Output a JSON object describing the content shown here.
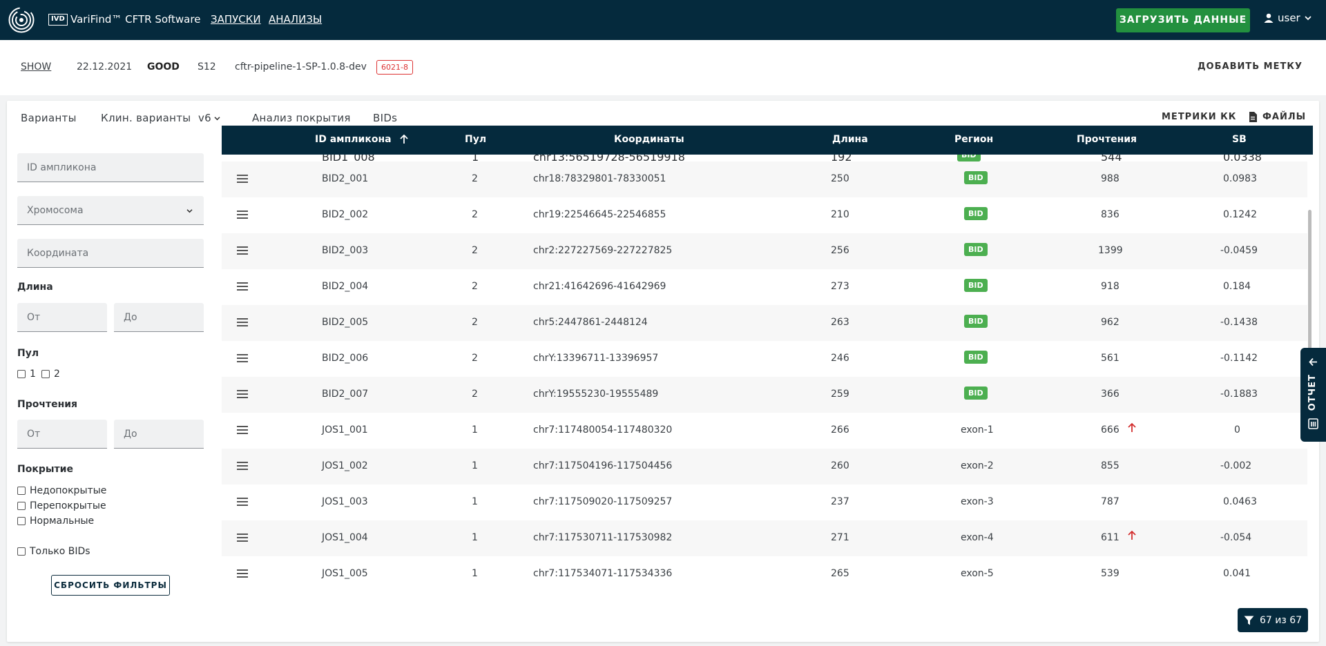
{
  "header": {
    "ivd_badge": "IVD",
    "app_title": "VariFind™ CFTR Software",
    "nav": [
      "ЗАПУСКИ",
      "АНАЛИЗЫ"
    ],
    "upload_label": "ЗАГРУЗИТЬ ДАННЫЕ",
    "user_label": "user"
  },
  "run": {
    "show_label": "SHOW",
    "date": "22.12.2021",
    "quality": "GOOD",
    "sample": "S12",
    "pipeline": "cftr-pipeline-1-SP-1.0.8-dev",
    "badge": "6021-8",
    "add_tag_label": "ДОБАВИТЬ МЕТКУ"
  },
  "tabs": {
    "variants": "Варианты",
    "clin_variants": "Клин. варианты",
    "version": "v6",
    "coverage": "Анализ покрытия",
    "bids": "BIDs",
    "qc_metrics": "МЕТРИКИ КК",
    "files": "ФАЙЛЫ"
  },
  "filters": {
    "amplicon_placeholder": "ID ампликона",
    "chromosome_placeholder": "Хромосома",
    "coordinate_placeholder": "Координата",
    "length_label": "Длина",
    "from_placeholder": "От",
    "to_placeholder": "До",
    "pool_label": "Пул",
    "pool_options": [
      "1",
      "2"
    ],
    "reads_label": "Прочтения",
    "coverage_label": "Покрытие",
    "coverage_options": [
      "Недопокрытые",
      "Перепокрытые",
      "Нормальные"
    ],
    "only_bids_label": "Только BIDs",
    "reset_label": "СБРОСИТЬ ФИЛЬТРЫ"
  },
  "table": {
    "columns": [
      "ID ампликона",
      "Пул",
      "Координаты",
      "Длина",
      "Регион",
      "Прочтения",
      "SB"
    ],
    "partial_row": {
      "id": "BID1_008",
      "pool": "1",
      "coords": "chr13:56519728-56519918",
      "length": "192",
      "region": "BID",
      "reads": "544",
      "sb": "0.0338"
    },
    "rows": [
      {
        "id": "BID2_001",
        "pool": "2",
        "coords": "chr18:78329801-78330051",
        "length": "250",
        "region": "BID",
        "region_badge": true,
        "reads": "988",
        "reads_flag": false,
        "sb": "0.0983"
      },
      {
        "id": "BID2_002",
        "pool": "2",
        "coords": "chr19:22546645-22546855",
        "length": "210",
        "region": "BID",
        "region_badge": true,
        "reads": "836",
        "reads_flag": false,
        "sb": "0.1242"
      },
      {
        "id": "BID2_003",
        "pool": "2",
        "coords": "chr2:227227569-227227825",
        "length": "256",
        "region": "BID",
        "region_badge": true,
        "reads": "1399",
        "reads_flag": false,
        "sb": "-0.0459"
      },
      {
        "id": "BID2_004",
        "pool": "2",
        "coords": "chr21:41642696-41642969",
        "length": "273",
        "region": "BID",
        "region_badge": true,
        "reads": "918",
        "reads_flag": false,
        "sb": "0.184"
      },
      {
        "id": "BID2_005",
        "pool": "2",
        "coords": "chr5:2447861-2448124",
        "length": "263",
        "region": "BID",
        "region_badge": true,
        "reads": "962",
        "reads_flag": false,
        "sb": "-0.1438"
      },
      {
        "id": "BID2_006",
        "pool": "2",
        "coords": "chrY:13396711-13396957",
        "length": "246",
        "region": "BID",
        "region_badge": true,
        "reads": "561",
        "reads_flag": false,
        "sb": "-0.1142"
      },
      {
        "id": "BID2_007",
        "pool": "2",
        "coords": "chrY:19555230-19555489",
        "length": "259",
        "region": "BID",
        "region_badge": true,
        "reads": "366",
        "reads_flag": false,
        "sb": "-0.1883"
      },
      {
        "id": "JOS1_001",
        "pool": "1",
        "coords": "chr7:117480054-117480320",
        "length": "266",
        "region": "exon-1",
        "region_badge": false,
        "reads": "666",
        "reads_flag": true,
        "sb": "0"
      },
      {
        "id": "JOS1_002",
        "pool": "1",
        "coords": "chr7:117504196-117504456",
        "length": "260",
        "region": "exon-2",
        "region_badge": false,
        "reads": "855",
        "reads_flag": false,
        "sb": "-0.002"
      },
      {
        "id": "JOS1_003",
        "pool": "1",
        "coords": "chr7:117509020-117509257",
        "length": "237",
        "region": "exon-3",
        "region_badge": false,
        "reads": "787",
        "reads_flag": false,
        "sb": "0.0463"
      },
      {
        "id": "JOS1_004",
        "pool": "1",
        "coords": "chr7:117530711-117530982",
        "length": "271",
        "region": "exon-4",
        "region_badge": false,
        "reads": "611",
        "reads_flag": true,
        "sb": "-0.054"
      },
      {
        "id": "JOS1_005",
        "pool": "1",
        "coords": "chr7:117534071-117534336",
        "length": "265",
        "region": "exon-5",
        "region_badge": false,
        "reads": "539",
        "reads_flag": false,
        "sb": "0.041"
      }
    ]
  },
  "report_tab_label": "ОТЧЕТ",
  "filter_count": "67 из 67",
  "colors": {
    "header_bg": "#052a3d",
    "accent": "#f08a1c",
    "upload": "#23903f",
    "bid_badge": "#4caf50",
    "flag": "#d32f2f"
  }
}
